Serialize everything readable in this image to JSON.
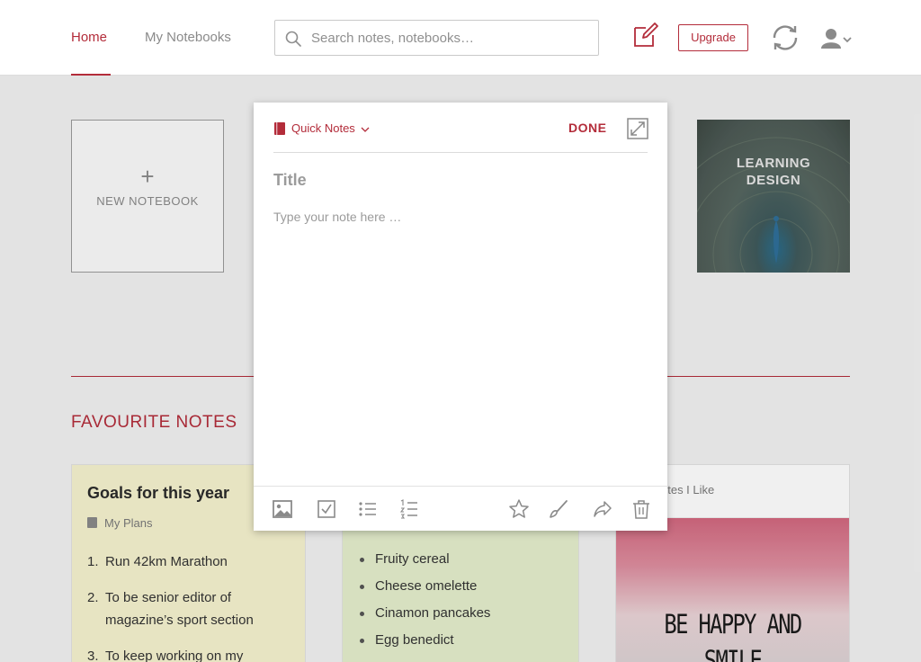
{
  "header": {
    "tabs": [
      {
        "label": "Home",
        "active": true
      },
      {
        "label": "My Notebooks",
        "active": false
      }
    ],
    "search": {
      "placeholder": "Search notes, notebooks…",
      "value": ""
    },
    "upgrade_label": "Upgrade",
    "icons": [
      "search-icon",
      "new-note-icon",
      "sync-icon",
      "user-icon",
      "chevron-down-icon"
    ]
  },
  "notebooks": {
    "new_plus": "+",
    "new_label": "NEW NOTEBOOK",
    "cover_title_line1": "LEARNING",
    "cover_title_line2": "DESIGN"
  },
  "favourites": {
    "heading": "FAVOURITE NOTES",
    "goals": {
      "title": "Goals for this year",
      "notebook": "My Plans",
      "items": [
        {
          "num": "1.",
          "text": "Run 42km Marathon"
        },
        {
          "num": "2.",
          "text": "To be senior editor of magazine’s  sport section"
        },
        {
          "num": "3.",
          "text": "To keep working on my"
        }
      ]
    },
    "breakfast": {
      "items": [
        "Fruity cereal",
        "Cheese omelette",
        "Cinamon pancakes",
        "Egg benedict"
      ]
    },
    "quotes": {
      "notebook": "otes I Like",
      "image_text": "BE HAPPY AND SMILE"
    }
  },
  "editor": {
    "notebook_label": "Quick Notes",
    "done_label": "DONE",
    "title_placeholder": "Title",
    "body_placeholder": "Type your note here …",
    "toolbar_icons": [
      "image-icon",
      "checkbox-icon",
      "bulleted-list-icon",
      "numbered-list-icon",
      "star-icon",
      "brush-icon",
      "share-icon",
      "trash-icon"
    ]
  },
  "colors": {
    "accent": "#b32c3a",
    "goals_card": "#f6f3cf",
    "breakfast_card": "#e5efcd"
  }
}
